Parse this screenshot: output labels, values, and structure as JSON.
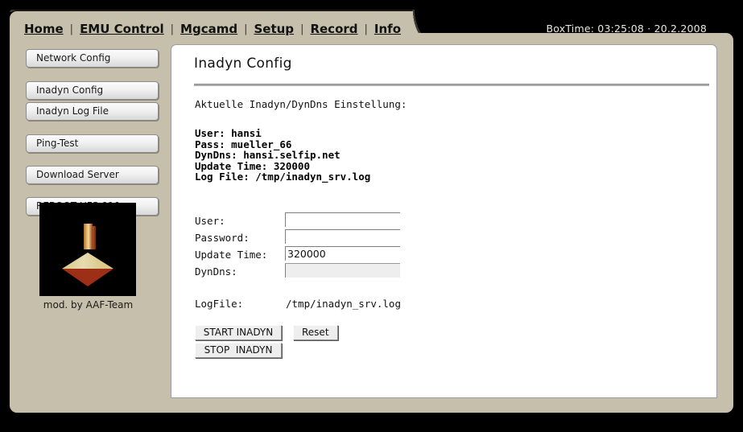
{
  "header": {
    "nav_items": [
      {
        "label": "Home"
      },
      {
        "label": "EMU Control"
      },
      {
        "label": "Mgcamd"
      },
      {
        "label": "Setup"
      },
      {
        "label": "Record"
      },
      {
        "label": "Info"
      }
    ],
    "separator": "|",
    "boxtime": "BoxTime: 03:25:08 · 20.2.2008"
  },
  "sidebar": {
    "buttons": [
      {
        "label": "Network Config"
      },
      {
        "label": "Inadyn Config"
      },
      {
        "label": "Inadyn Log File"
      },
      {
        "label": "Ping-Test"
      },
      {
        "label": "Download Server"
      },
      {
        "label": "REBOOT UFS-910"
      }
    ],
    "logo_caption": "mod. by AAF-Team"
  },
  "main": {
    "title": "Inadyn Config",
    "intro": "Aktuelle Inadyn/DynDns Einstellung:",
    "current_settings": {
      "lines": [
        "User: hansi",
        "Pass: mueller_66",
        "DynDns: hansi.selfip.net",
        "Update Time: 320000",
        "Log File: /tmp/inadyn_srv.log"
      ],
      "text": "User: hansi\nPass: mueller_66\nDynDns: hansi.selfip.net\nUpdate Time: 320000\nLog File: /tmp/inadyn_srv.log"
    },
    "form": {
      "fields": [
        {
          "label": "User:",
          "value": "",
          "placeholder": ""
        },
        {
          "label": "Password:",
          "value": "",
          "placeholder": ""
        },
        {
          "label": "Update Time:",
          "value": "320000",
          "placeholder": ""
        },
        {
          "label": "DynDns:",
          "value": "",
          "placeholder": ""
        }
      ],
      "logfile_label": "LogFile:",
      "logfile_value": "/tmp/inadyn_srv.log"
    },
    "buttons": {
      "start": "START INADYN",
      "reset": "Reset",
      "stop": "STOP  INADYN"
    }
  },
  "colors": {
    "page_background": "#000000",
    "shell_beige": "#c5bfab",
    "content_white": "#ffffff",
    "text_dark": "#111111",
    "border_grey": "#9d9d9d",
    "button_face": "#eeeeee"
  }
}
